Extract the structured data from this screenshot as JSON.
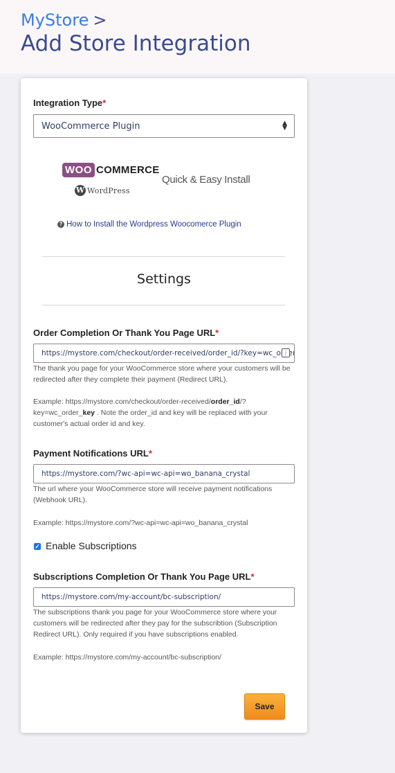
{
  "header": {
    "breadcrumb_link": "MyStore",
    "breadcrumb_sep": ">",
    "title": "Add Store Integration"
  },
  "integration": {
    "label": "Integration Type",
    "required_mark": "*",
    "selected": "WooCommerce Plugin",
    "logo_woo_badge": "WOO",
    "logo_woo_text": "COMMERCE",
    "logo_wp_text": "WordPress",
    "quick_install": "Quick & Easy Install",
    "howto_link": "How to Install the Wordpress Woocomerce Plugin"
  },
  "settings": {
    "heading": "Settings"
  },
  "order_url": {
    "label": "Order Completion Or Thank You Page URL",
    "required_mark": "*",
    "value": "https://mystore.com/checkout/order-received/order_id/?key=wc_order_key",
    "help": "The thank you page for your WooCommerce store where your customers will be redirected after they complete their payment (Redirect URL).",
    "example_prefix": "Example: https://mystore.com/checkout/order-received/",
    "example_bold1": "order_id",
    "example_mid": "/?key=wc_order_",
    "example_bold2": "key",
    "example_suffix": " . Note the order_id and key will be replaced with your customer's actual order id and key."
  },
  "payment_url": {
    "label": "Payment Notifications URL",
    "required_mark": "*",
    "value": "https://mystore.com/?wc-api=wc-api=wo_banana_crystal",
    "help": "The url where your WooCommerce store will receive payment notifications (Webhook URL).",
    "example": "Example: https://mystore.com/?wc-api=wc-api=wo_banana_crystal"
  },
  "subscriptions_toggle": {
    "label": "Enable Subscriptions",
    "checked": true
  },
  "subscription_url": {
    "label": "Subscriptions Completion Or Thank You Page URL",
    "required_mark": "*",
    "value": "https://mystore.com/my-account/bc-subscription/",
    "help": "The subscriptions thank you page for your WooCommerce store where your customers will be redirected after they pay for the subscribtion (Subscription Redirect URL). Only required if you have subscriptions enabled.",
    "example": "Example: https://mystore.com/my-account/bc-subscription/"
  },
  "actions": {
    "save_label": "Save"
  },
  "colors": {
    "accent": "#3b4a8f",
    "link": "#3b7ddd",
    "required": "#e02424",
    "save_button": "#f5a02a",
    "checkbox": "#1a73e8"
  }
}
